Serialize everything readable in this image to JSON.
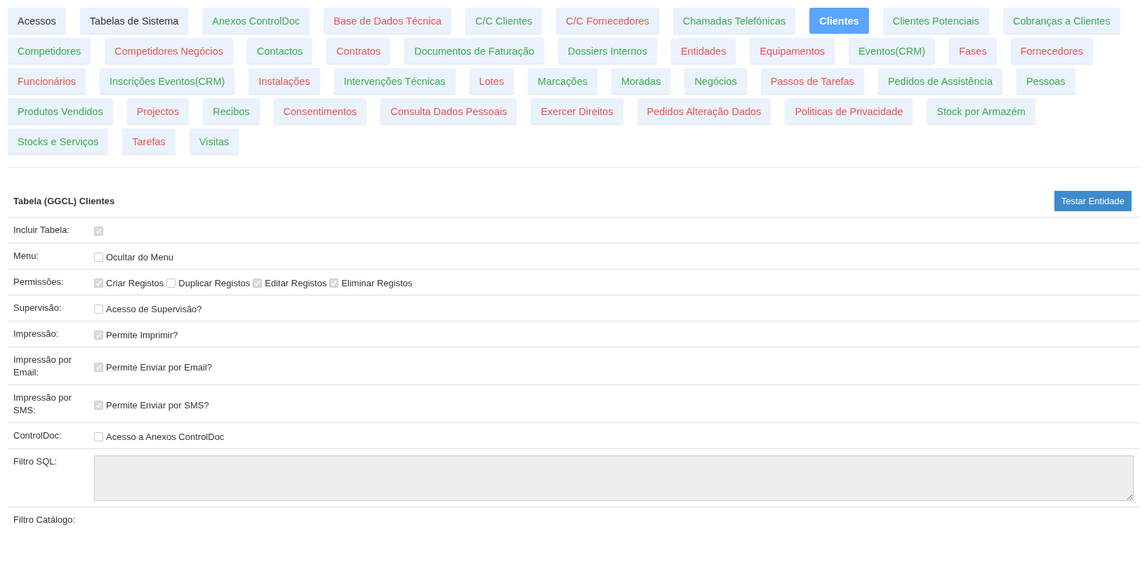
{
  "tabs": [
    {
      "label": "Acessos",
      "kind": "neutral",
      "selected": false
    },
    {
      "label": "Tabelas de Sistema",
      "kind": "neutral",
      "selected": false
    },
    {
      "label": "Anexos ControlDoc",
      "kind": "positive",
      "selected": false
    },
    {
      "label": "Base de Dados Técnica",
      "kind": "negative",
      "selected": false
    },
    {
      "label": "C/C Clientes",
      "kind": "positive",
      "selected": false
    },
    {
      "label": "C/C Fornecedores",
      "kind": "negative",
      "selected": false
    },
    {
      "label": "Chamadas Telefónicas",
      "kind": "positive",
      "selected": false
    },
    {
      "label": "Clientes",
      "kind": "positive",
      "selected": true
    },
    {
      "label": "Clientes Potenciais",
      "kind": "positive",
      "selected": false
    },
    {
      "label": "Cobranças a Clientes",
      "kind": "positive",
      "selected": false
    },
    {
      "label": "Competidores",
      "kind": "positive",
      "selected": false
    },
    {
      "label": "Competidores Negócios",
      "kind": "negative",
      "selected": false
    },
    {
      "label": "Contactos",
      "kind": "positive",
      "selected": false
    },
    {
      "label": "Contratos",
      "kind": "negative",
      "selected": false
    },
    {
      "label": "Documentos de Faturação",
      "kind": "positive",
      "selected": false
    },
    {
      "label": "Dossiers Internos",
      "kind": "positive",
      "selected": false
    },
    {
      "label": "Entidades",
      "kind": "negative",
      "selected": false
    },
    {
      "label": "Equipamentos",
      "kind": "negative",
      "selected": false
    },
    {
      "label": "Eventos(CRM)",
      "kind": "positive",
      "selected": false
    },
    {
      "label": "Fases",
      "kind": "negative",
      "selected": false
    },
    {
      "label": "Fornecedores",
      "kind": "negative",
      "selected": false
    },
    {
      "label": "Funcionários",
      "kind": "negative",
      "selected": false
    },
    {
      "label": "Inscrições Eventos(CRM)",
      "kind": "positive",
      "selected": false
    },
    {
      "label": "Instalações",
      "kind": "negative",
      "selected": false
    },
    {
      "label": "Intervenções Técnicas",
      "kind": "positive",
      "selected": false
    },
    {
      "label": "Lotes",
      "kind": "negative",
      "selected": false
    },
    {
      "label": "Marcações",
      "kind": "positive",
      "selected": false
    },
    {
      "label": "Moradas",
      "kind": "positive",
      "selected": false
    },
    {
      "label": "Negócios",
      "kind": "positive",
      "selected": false
    },
    {
      "label": "Passos de Tarefas",
      "kind": "negative",
      "selected": false
    },
    {
      "label": "Pedidos de Assistência",
      "kind": "positive",
      "selected": false
    },
    {
      "label": "Pessoas",
      "kind": "positive",
      "selected": false
    },
    {
      "label": "Produtos Vendidos",
      "kind": "positive",
      "selected": false
    },
    {
      "label": "Projectos",
      "kind": "negative",
      "selected": false
    },
    {
      "label": "Recibos",
      "kind": "positive",
      "selected": false
    },
    {
      "label": "Consentimentos",
      "kind": "negative",
      "selected": false
    },
    {
      "label": "Consulta Dados Pessoais",
      "kind": "negative",
      "selected": false
    },
    {
      "label": "Exercer Direitos",
      "kind": "negative",
      "selected": false
    },
    {
      "label": "Pedidos Alteração Dados",
      "kind": "negative",
      "selected": false
    },
    {
      "label": "Politicas de Privacidade",
      "kind": "negative",
      "selected": false
    },
    {
      "label": "Stock por Armazém",
      "kind": "positive",
      "selected": false
    },
    {
      "label": "Stocks e Serviços",
      "kind": "positive",
      "selected": false
    },
    {
      "label": "Tarefas",
      "kind": "negative",
      "selected": false
    },
    {
      "label": "Visitas",
      "kind": "positive",
      "selected": false
    }
  ],
  "panel": {
    "title": "Tabela (GGCL) Clientes",
    "test_button": "Testar Entidade",
    "rows": [
      {
        "label": "Incluir Tabela:",
        "kind": "checks",
        "options": [
          {
            "checked": true
          }
        ]
      },
      {
        "label": "Menu:",
        "kind": "checks",
        "options": [
          {
            "label": "Ocultar do Menu",
            "checked": false
          }
        ]
      },
      {
        "label": "Permissões:",
        "kind": "checks",
        "options": [
          {
            "label": "Criar Registos",
            "checked": true
          },
          {
            "label": "Duplicar Registos",
            "checked": false
          },
          {
            "label": "Editar Registos",
            "checked": true
          },
          {
            "label": "Eliminar Registos",
            "checked": true
          }
        ]
      },
      {
        "label": "Supervisão:",
        "kind": "checks",
        "options": [
          {
            "label": "Acesso de Supervisão?",
            "checked": false
          }
        ]
      },
      {
        "label": "Impressão:",
        "kind": "checks",
        "options": [
          {
            "label": "Permite Imprimir?",
            "checked": true
          }
        ]
      },
      {
        "label": "Impressão por Email:",
        "kind": "checks",
        "options": [
          {
            "label": "Permite Enviar por Email?",
            "checked": true
          }
        ]
      },
      {
        "label": "Impressão por SMS:",
        "kind": "checks",
        "options": [
          {
            "label": "Permite Enviar por SMS?",
            "checked": true
          }
        ]
      },
      {
        "label": "ControlDoc:",
        "kind": "checks",
        "options": [
          {
            "label": "Acesso a Anexos ControlDoc",
            "checked": false
          }
        ]
      },
      {
        "label": "Filtro SQL:",
        "kind": "textarea"
      },
      {
        "label": "Filtro Catálogo:",
        "kind": "empty"
      }
    ]
  }
}
